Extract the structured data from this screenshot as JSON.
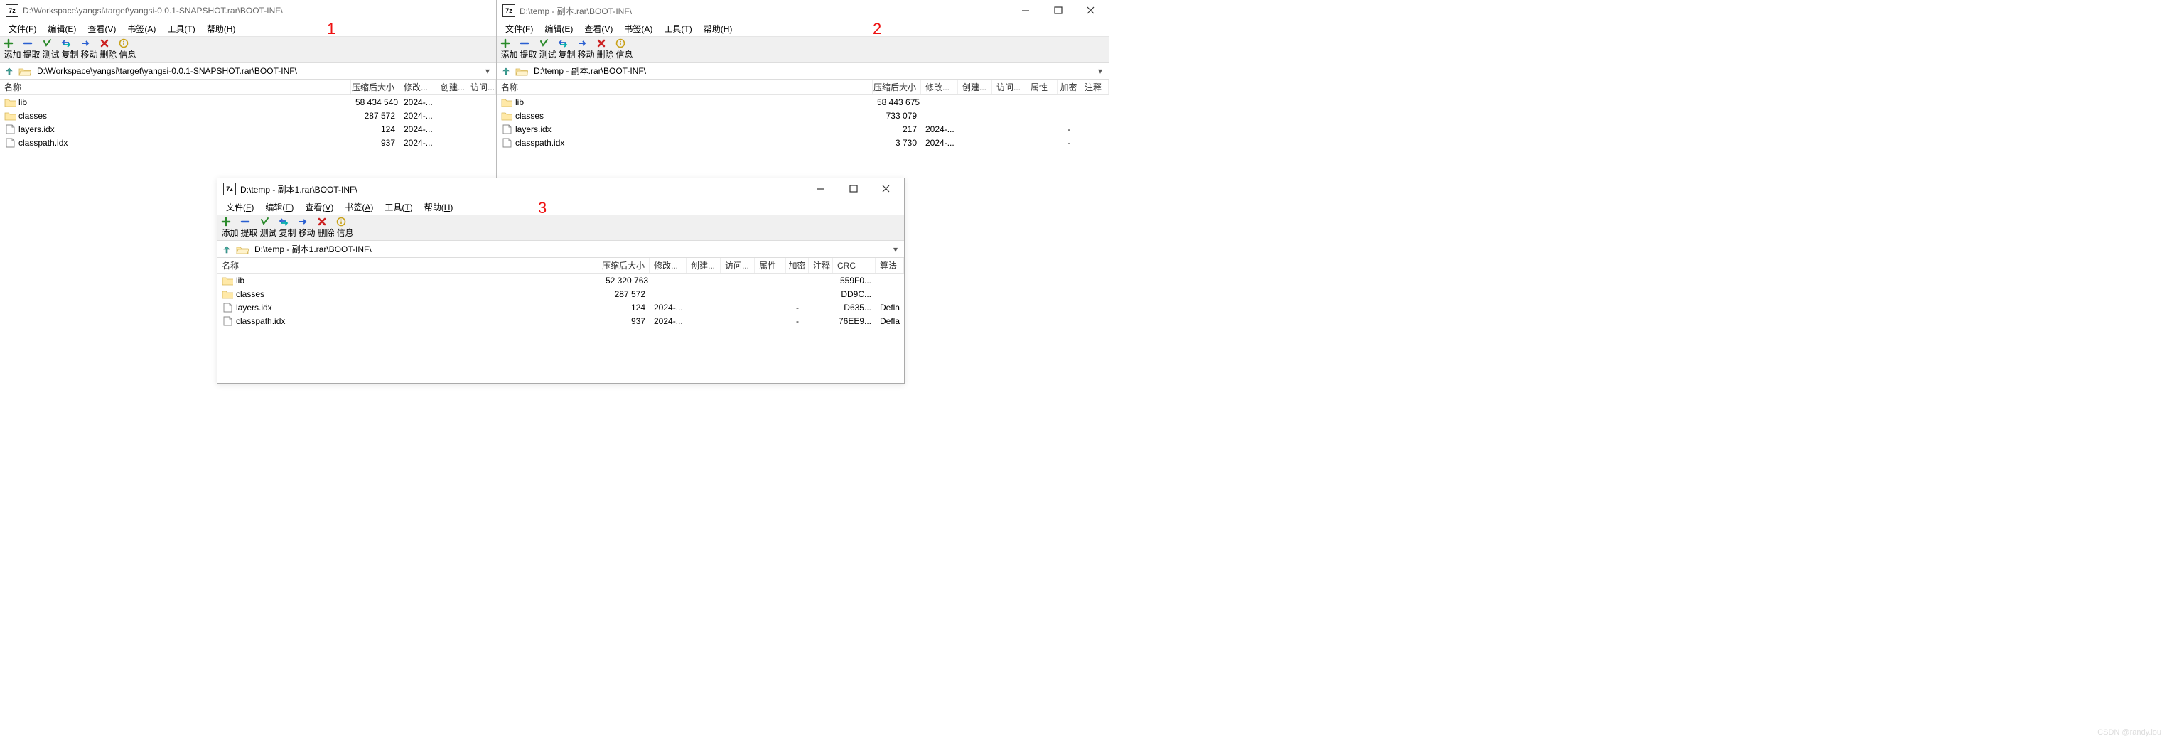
{
  "windows": [
    {
      "id": "w1",
      "title": "D:\\Workspace\\yangsi\\target\\yangsi-0.0.1-SNAPSHOT.rar\\BOOT-INF\\",
      "path": "D:\\Workspace\\yangsi\\target\\yangsi-0.0.1-SNAPSHOT.rar\\BOOT-INF\\",
      "annot": "1",
      "cols_visible": [
        "name",
        "size",
        "mod",
        "created",
        "access"
      ],
      "col_widths": {
        "name": 380,
        "size": 68,
        "mod": 52,
        "created": 42,
        "access": 42
      },
      "rows": [
        {
          "icon": "folder",
          "name": "lib",
          "size": "58 434 540",
          "mod": "2024-..."
        },
        {
          "icon": "folder",
          "name": "classes",
          "size": "287 572",
          "mod": "2024-..."
        },
        {
          "icon": "file",
          "name": "layers.idx",
          "size": "124",
          "mod": "2024-..."
        },
        {
          "icon": "file",
          "name": "classpath.idx",
          "size": "937",
          "mod": "2024-..."
        }
      ]
    },
    {
      "id": "w2",
      "title": "D:\\temp - 副本.rar\\BOOT-INF\\",
      "path": "D:\\temp - 副本.rar\\BOOT-INF\\",
      "annot": "2",
      "show_win_controls": true,
      "cols_visible": [
        "name",
        "size",
        "mod",
        "created",
        "access",
        "attr",
        "enc",
        "note"
      ],
      "col_widths": {
        "name": 495,
        "size": 68,
        "mod": 52,
        "created": 48,
        "access": 48,
        "attr": 44,
        "enc": 32,
        "note": 40
      },
      "rows": [
        {
          "icon": "folder",
          "name": "lib",
          "size": "58 443 675",
          "mod": ""
        },
        {
          "icon": "folder",
          "name": "classes",
          "size": "733 079",
          "mod": ""
        },
        {
          "icon": "file",
          "name": "layers.idx",
          "size": "217",
          "mod": "2024-...",
          "enc": "-"
        },
        {
          "icon": "file",
          "name": "classpath.idx",
          "size": "3 730",
          "mod": "2024-...",
          "enc": "-"
        }
      ]
    },
    {
      "id": "w3",
      "title": "D:\\temp - 副本1.rar\\BOOT-INF\\",
      "path": "D:\\temp - 副本1.rar\\BOOT-INF\\",
      "annot": "3",
      "show_win_controls": true,
      "cols_visible": [
        "name",
        "size",
        "mod",
        "created",
        "access",
        "attr",
        "enc",
        "note",
        "crc",
        "algo"
      ],
      "col_widths": {
        "name": 508,
        "size": 68,
        "mod": 52,
        "created": 48,
        "access": 48,
        "attr": 44,
        "enc": 32,
        "note": 34,
        "crc": 60,
        "algo": 40
      },
      "rows": [
        {
          "icon": "folder",
          "name": "lib",
          "size": "52 320 763",
          "mod": "",
          "crc": "559F0..."
        },
        {
          "icon": "folder",
          "name": "classes",
          "size": "287 572",
          "mod": "",
          "crc": "DD9C..."
        },
        {
          "icon": "file",
          "name": "layers.idx",
          "size": "124",
          "mod": "2024-...",
          "enc": "-",
          "crc": "D635...",
          "algo": "Defla"
        },
        {
          "icon": "file",
          "name": "classpath.idx",
          "size": "937",
          "mod": "2024-...",
          "enc": "-",
          "crc": "76EE9...",
          "algo": "Defla"
        }
      ]
    }
  ],
  "menu": {
    "items": [
      {
        "label": "文件",
        "hk": "F"
      },
      {
        "label": "编辑",
        "hk": "E"
      },
      {
        "label": "查看",
        "hk": "V"
      },
      {
        "label": "书签",
        "hk": "A"
      },
      {
        "label": "工具",
        "hk": "T"
      },
      {
        "label": "帮助",
        "hk": "H"
      }
    ]
  },
  "toolbar": {
    "labels": [
      "添加",
      "提取",
      "测试",
      "复制",
      "移动",
      "删除",
      "信息"
    ]
  },
  "columns": {
    "name": "名称",
    "size": "压缩后大小",
    "mod": "修改...",
    "created": "创建...",
    "access": "访问...",
    "attr": "属性",
    "enc": "加密",
    "note": "注释",
    "crc": "CRC",
    "algo": "算法"
  },
  "watermark": "CSDN @randy.lou"
}
